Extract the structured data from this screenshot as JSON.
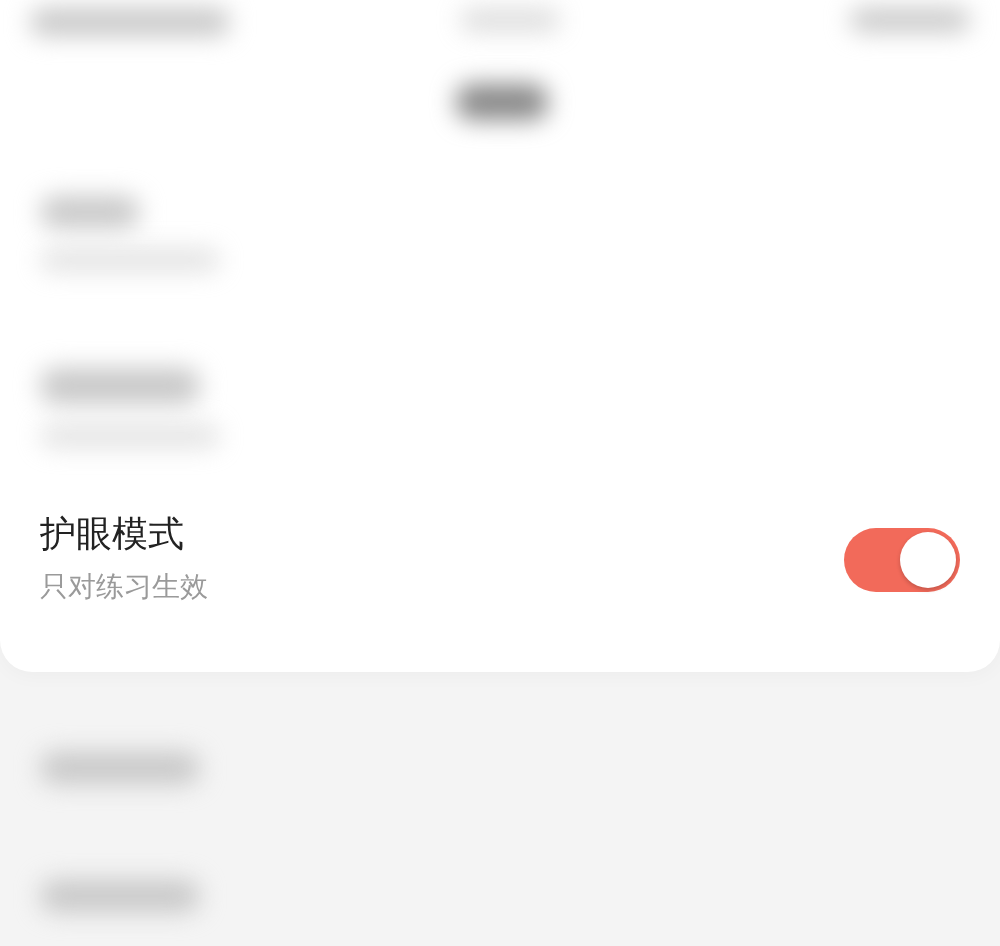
{
  "setting": {
    "title": "护眼模式",
    "subtitle": "只对练习生效",
    "on": true
  }
}
